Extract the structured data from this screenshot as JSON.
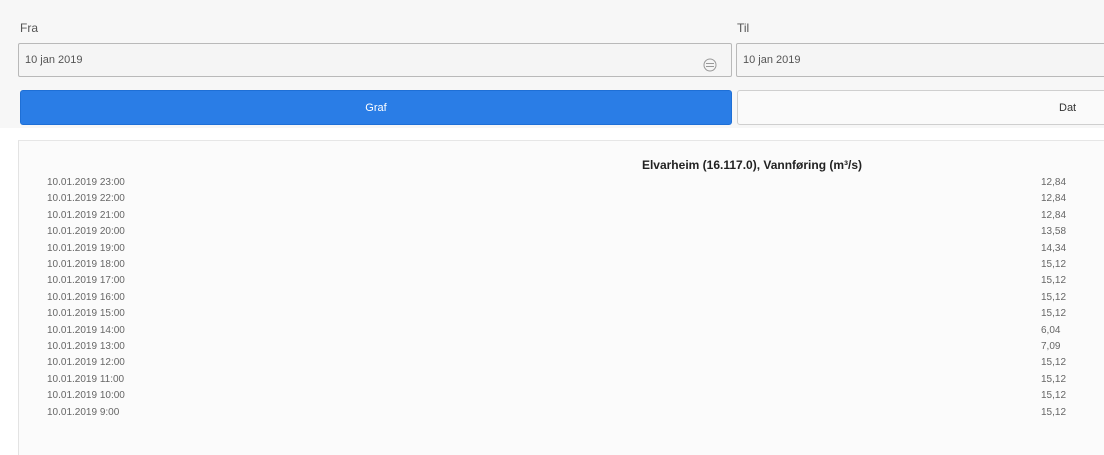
{
  "from": {
    "label": "Fra",
    "value": "10 jan 2019"
  },
  "to": {
    "label": "Til",
    "value": "10 jan 2019"
  },
  "buttons": {
    "graf": "Graf",
    "data": "Dat"
  },
  "table": {
    "title": "Elvarheim (16.117.0), Vannføring (m³/s)",
    "rows": [
      {
        "time": "10.01.2019 23:00",
        "value": "12,84"
      },
      {
        "time": "10.01.2019 22:00",
        "value": "12,84"
      },
      {
        "time": "10.01.2019 21:00",
        "value": "12,84"
      },
      {
        "time": "10.01.2019 20:00",
        "value": "13,58"
      },
      {
        "time": "10.01.2019 19:00",
        "value": "14,34"
      },
      {
        "time": "10.01.2019 18:00",
        "value": "15,12"
      },
      {
        "time": "10.01.2019 17:00",
        "value": "15,12"
      },
      {
        "time": "10.01.2019 16:00",
        "value": "15,12"
      },
      {
        "time": "10.01.2019 15:00",
        "value": "15,12"
      },
      {
        "time": "10.01.2019 14:00",
        "value": "6,04"
      },
      {
        "time": "10.01.2019 13:00",
        "value": "7,09"
      },
      {
        "time": "10.01.2019 12:00",
        "value": "15,12"
      },
      {
        "time": "10.01.2019 11:00",
        "value": "15,12"
      },
      {
        "time": "10.01.2019 10:00",
        "value": "15,12"
      },
      {
        "time": "10.01.2019 9:00",
        "value": "15,12"
      }
    ]
  }
}
